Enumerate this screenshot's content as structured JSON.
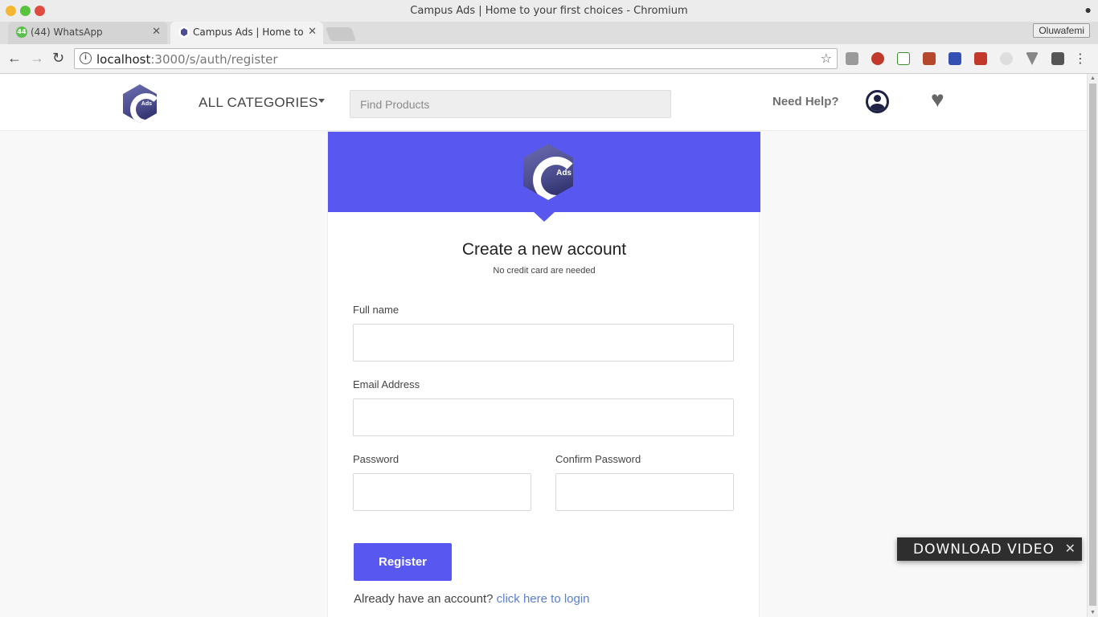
{
  "window": {
    "title": "Campus Ads | Home to your first choices - Chromium",
    "menu_dot": "●"
  },
  "tabs": [
    {
      "label": "(44) WhatsApp",
      "badge": "44",
      "close": "✕"
    },
    {
      "label": "Campus Ads | Home to your first choices",
      "close": "✕"
    }
  ],
  "profile_name": "Oluwafemi",
  "address_bar": {
    "url_host": "localhost",
    "url_rest": ":3000/s/auth/register"
  },
  "extension_icons": [
    "gallery-icon",
    "adblock-icon",
    "bw-icon",
    "book-icon",
    "tag-icon",
    "photo-icon",
    "clock-icon",
    "vuejs-icon",
    "lightbulb-icon"
  ],
  "header": {
    "all_categories": "ALL CATEGORIES",
    "search_placeholder": "Find Products",
    "need_help": "Need Help?",
    "logo_text": "Ads"
  },
  "form": {
    "title": "Create a new account",
    "subtitle": "No credit card are needed",
    "full_name_label": "Full name",
    "email_label": "Email Address",
    "password_label": "Password",
    "confirm_password_label": "Confirm Password",
    "register_button": "Register",
    "login_prompt": "Already have an account?",
    "login_link": "click here to login"
  },
  "overlay": {
    "download_video": "DOWNLOAD VIDEO",
    "close": "✕"
  },
  "colors": {
    "accent": "#5858f0",
    "logo": "#4b4d8e",
    "link": "#5b7fd0"
  }
}
